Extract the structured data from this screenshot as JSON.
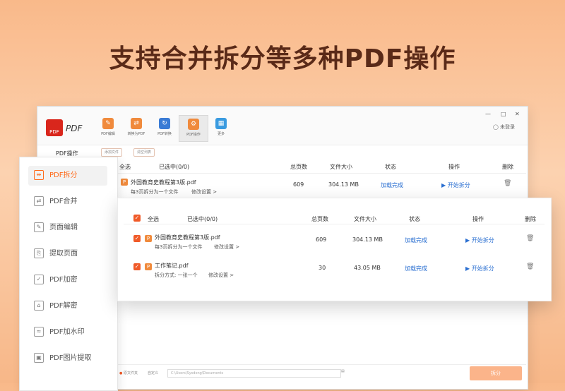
{
  "headline": "支持合并拆分等多种PDF操作",
  "app": {
    "logo_label": "PDF",
    "logo_text": "PDF",
    "tools": [
      {
        "label": "PDF编辑",
        "glyph": "✎"
      },
      {
        "label": "转换为PDF",
        "glyph": "⇄"
      },
      {
        "label": "PDF转换",
        "glyph": "↻"
      },
      {
        "label": "PDF操作",
        "glyph": "⚙"
      },
      {
        "label": "更多",
        "glyph": "▦"
      }
    ],
    "user_label": "未登录",
    "tab_label": "PDF操作",
    "add_file_btn": "添加文件",
    "clear_list_btn": "清空列表"
  },
  "sidebar": {
    "items": [
      {
        "label": "PDF拆分",
        "icon": "split-icon"
      },
      {
        "label": "PDF合并",
        "icon": "merge-icon"
      },
      {
        "label": "页面编辑",
        "icon": "page-edit-icon"
      },
      {
        "label": "提取页面",
        "icon": "extract-icon"
      },
      {
        "label": "PDF加密",
        "icon": "shield-icon"
      },
      {
        "label": "PDF解密",
        "icon": "unlock-icon"
      },
      {
        "label": "PDF加水印",
        "icon": "watermark-icon"
      },
      {
        "label": "PDF图片提取",
        "icon": "image-icon"
      }
    ]
  },
  "back_table": {
    "select_all": "全选",
    "selected": "已选中(0/0)",
    "col_pages": "总页数",
    "col_size": "文件大小",
    "col_status": "状态",
    "col_action": "操作",
    "col_delete": "删除",
    "row": {
      "name": "外国教育史教程第3版.pdf",
      "sub": "每3页拆分为一个文件",
      "modify": "修改设置 >",
      "pages": "609",
      "size": "304.13 MB",
      "status": "加载完成",
      "action": "▶ 开始拆分"
    },
    "source_dir": "原文件夹",
    "custom": "自定义",
    "path_placeholder": "C:\\Users\\Sysdong\\Documents",
    "split_btn": "拆分"
  },
  "card": {
    "select_all": "全选",
    "selected": "已选中(0/0)",
    "col_pages": "总页数",
    "col_size": "文件大小",
    "col_status": "状态",
    "col_action": "操作",
    "col_delete": "删除",
    "rows": [
      {
        "name": "外国教育史教程第3版.pdf",
        "sub": "每3页拆分为一个文件",
        "modify": "修改设置 >",
        "pages": "609",
        "size": "304.13 MB",
        "status": "加载完成",
        "action": "▶ 开始拆分"
      },
      {
        "name": "工作笔记.pdf",
        "sub": "拆分方式: 一张一个",
        "modify": "修改设置 >",
        "pages": "30",
        "size": "43.05 MB",
        "status": "加载完成",
        "action": "▶ 开始拆分"
      }
    ]
  },
  "colors": {
    "accent": "#f05a28",
    "link": "#2a6fd1"
  }
}
